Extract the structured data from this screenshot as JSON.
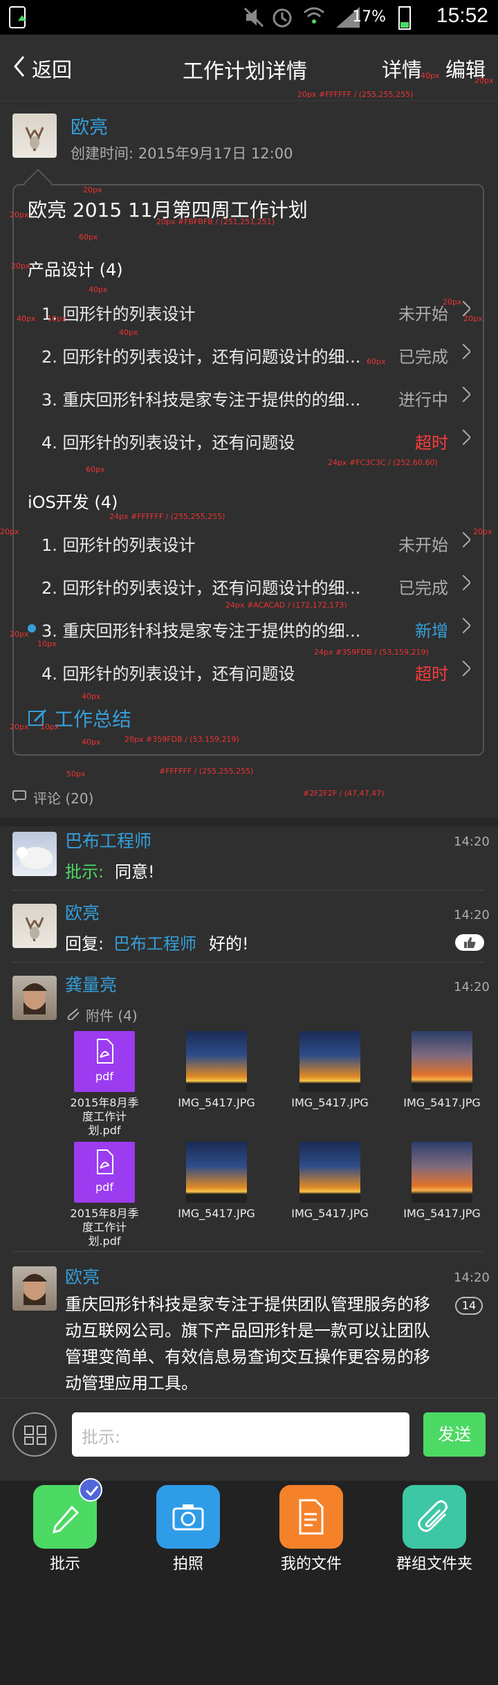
{
  "status": {
    "time": "15:52",
    "battery": "17%"
  },
  "nav": {
    "back_label": "返回",
    "title": "工作计划详情",
    "details_label": "详情",
    "edit_label": "编辑"
  },
  "header": {
    "author": "欧亮",
    "created": "创建时间: 2015年9月17日 12:00"
  },
  "plan": {
    "title": "欧亮 2015 11月第四周工作计划",
    "sections": [
      {
        "name": "产品设计 (4)",
        "items": [
          {
            "text": "1. 回形针的列表设计",
            "status": "未开始",
            "status_color": "#ACACAD"
          },
          {
            "text": "2. 回形针的列表设计，还有问题设计的细...",
            "status": "已完成",
            "status_color": "#ACACAD"
          },
          {
            "text": "3. 重庆回形针科技是家专注于提供的的细...",
            "status": "进行中",
            "status_color": "#ACACAD"
          },
          {
            "text": "4. 回形针的列表设计，还有问题设",
            "status": "超时",
            "status_color": "#FC3C3C"
          }
        ]
      },
      {
        "name": "iOS开发 (4)",
        "items": [
          {
            "text": "1. 回形针的列表设计",
            "status": "未开始",
            "status_color": "#ACACAD"
          },
          {
            "text": "2. 回形针的列表设计，还有问题设计的细...",
            "status": "已完成",
            "status_color": "#ACACAD"
          },
          {
            "text": "3. 重庆回形针科技是家专注于提供的的细...",
            "status": "新增",
            "status_color": "#359FDB"
          },
          {
            "text": "4. 回形针的列表设计，还有问题设",
            "status": "超时",
            "status_color": "#FC3C3C"
          }
        ]
      }
    ],
    "summary_label": "工作总结"
  },
  "comments": {
    "header": "评论 (20)",
    "list": [
      {
        "author": "巴布工程师",
        "time": "14:20",
        "prefix": "批示:",
        "text": "同意!"
      },
      {
        "author": "欧亮",
        "time": "14:20",
        "prefix": "回复:",
        "mention": "巴布工程师",
        "text": "好的!"
      },
      {
        "author": "龚量亮",
        "time": "14:20",
        "attachments_label": "附件 (4)"
      },
      {
        "author": "欧亮",
        "time": "14:20",
        "badge": "14",
        "text": "重庆回形针科技是家专注于提供团队管理服务的移动互联网公司。旗下产品回形针是一款可以让团队管理变简单、有效信息易查询交互操作更容易的移动管理应用工具。"
      }
    ]
  },
  "attachments": [
    {
      "name": "2015年8月季度工作计划.pdf",
      "kind": "pdf"
    },
    {
      "name": "IMG_5417.JPG",
      "kind": "image"
    },
    {
      "name": "IMG_5417.JPG",
      "kind": "image"
    },
    {
      "name": "IMG_5417.JPG",
      "kind": "image"
    },
    {
      "name": "2015年8月季度工作计划.pdf",
      "kind": "pdf"
    },
    {
      "name": "IMG_5417.JPG",
      "kind": "image"
    },
    {
      "name": "IMG_5417.JPG",
      "kind": "image"
    },
    {
      "name": "IMG_5417.JPG",
      "kind": "image"
    }
  ],
  "pdf_label": "pdf",
  "input": {
    "placeholder": "批示:",
    "send_label": "发送"
  },
  "actions": [
    {
      "label": "批示",
      "color": "#4CD964",
      "icon": "pencil-icon"
    },
    {
      "label": "拍照",
      "color": "#2F9CE8",
      "icon": "camera-icon"
    },
    {
      "label": "我的文件",
      "color": "#F5822A",
      "icon": "document-icon"
    },
    {
      "label": "群组文件夹",
      "color": "#3EC7A5",
      "icon": "paperclip-icon"
    }
  ],
  "annotations": [
    "20px #FFFFFF / (255,255,255)",
    "40px",
    "20px",
    "20px",
    "20px",
    "20px #FBFBFB / (251,251,251)",
    "60px",
    "20px",
    "40px",
    "40px",
    "40px",
    "10px",
    "20px",
    "20px",
    "60px",
    "24px #FC3C3C / (252,60,60)",
    "60px",
    "20px",
    "20px",
    "24px #FFFFFF / (255,255,255)",
    "24px #ACACAD / (172,172,173)",
    "20px",
    "10px",
    "24px #359FDB / (53,159,219)",
    "40px",
    "20px",
    "10px",
    "28px #359FDB / (53,159,219)",
    "40px",
    "#FFFFFF / (255,255,255)",
    "50px",
    "#2F2F2F / (47,47,47)"
  ]
}
